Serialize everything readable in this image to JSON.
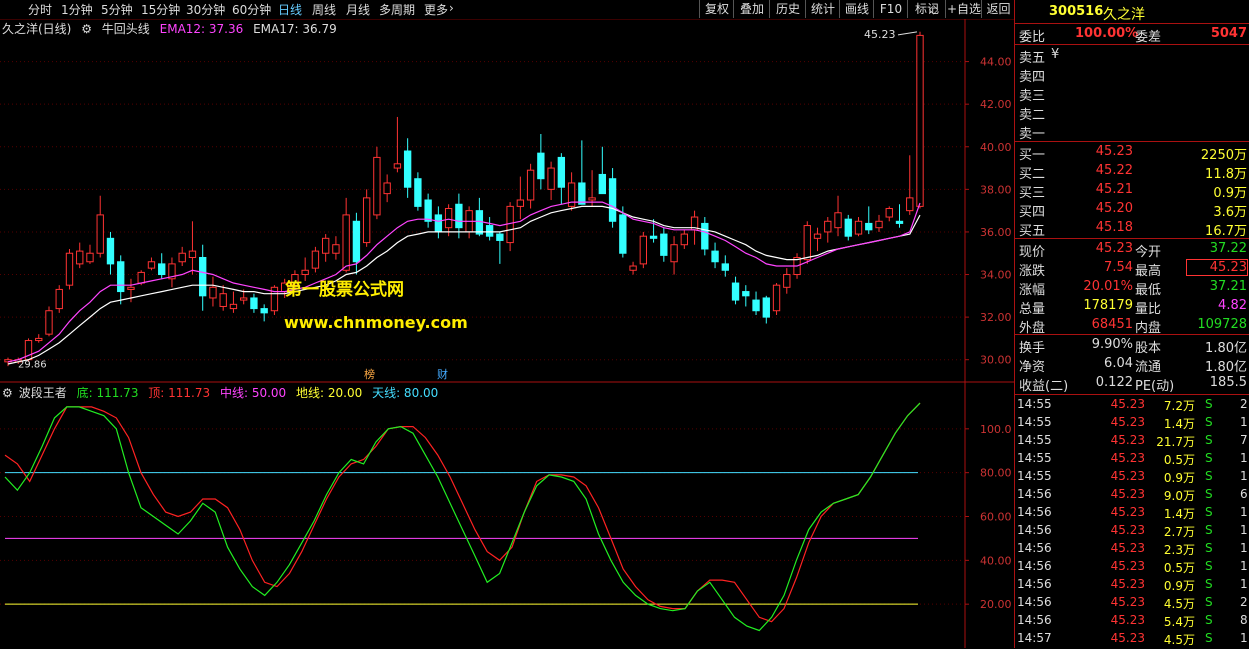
{
  "toolbar": {
    "tabs": [
      "分时",
      "1分钟",
      "5分钟",
      "15分钟",
      "30分钟",
      "60分钟",
      "日线",
      "周线",
      "月线",
      "多周期",
      "更多"
    ],
    "active": "日线",
    "more_arrow": "›",
    "right_buttons": [
      "复权",
      "叠加",
      "历史",
      "统计",
      "画线",
      "F10",
      "标记",
      "+自选",
      "返回"
    ],
    "diamond": "◇"
  },
  "main_legend": {
    "stock": "久之洋(日线)",
    "indicator": "牛回头线",
    "ema12": "EMA12: 37.36",
    "ema17": "EMA17: 36.79"
  },
  "price_axis": [
    "44.00",
    "42.00",
    "40.00",
    "38.00",
    "36.00",
    "34.00",
    "32.00",
    "30.00"
  ],
  "annotations": {
    "high": "45.23",
    "low": "29.86",
    "watermark1": "第一股票公式网",
    "watermark2": "www.chnmoney.com",
    "mark1": "榜",
    "mark2": "财"
  },
  "sub_legend": {
    "name": "波段王者",
    "di": "底: 111.73",
    "ding": "顶: 111.73",
    "mid": "中线: 50.00",
    "floor": "地线: 20.00",
    "sky": "天线: 80.00"
  },
  "sub_axis": [
    "100.0",
    "80.00",
    "60.00",
    "40.00",
    "20.00"
  ],
  "colors": {
    "up": "#ff3333",
    "down": "#33ffff",
    "ema12": "#ff44ff",
    "ema17": "#ffffff",
    "sky": "#44ddff",
    "mid": "#ff44ff",
    "floor": "#ffff33"
  },
  "chart_data": {
    "type": "candlestick",
    "candles": [
      [
        29.9,
        30.1,
        29.7,
        30.0
      ],
      [
        29.9,
        30.1,
        29.8,
        30.0
      ],
      [
        30.0,
        31.0,
        29.9,
        30.9
      ],
      [
        30.9,
        31.2,
        30.8,
        31.0
      ],
      [
        31.2,
        32.5,
        31.1,
        32.3
      ],
      [
        32.4,
        33.5,
        32.2,
        33.3
      ],
      [
        33.5,
        35.2,
        33.3,
        35.0
      ],
      [
        34.5,
        35.5,
        34.3,
        35.1
      ],
      [
        34.6,
        35.4,
        34.5,
        35.0
      ],
      [
        35.0,
        37.7,
        34.8,
        36.8
      ],
      [
        35.7,
        36.0,
        34.0,
        34.5
      ],
      [
        34.6,
        34.9,
        32.6,
        33.2
      ],
      [
        33.3,
        33.8,
        32.7,
        33.4
      ],
      [
        33.6,
        34.2,
        33.5,
        34.1
      ],
      [
        34.3,
        34.8,
        34.2,
        34.6
      ],
      [
        34.5,
        35.0,
        33.8,
        34.0
      ],
      [
        33.8,
        34.8,
        33.4,
        34.5
      ],
      [
        34.6,
        35.3,
        34.4,
        35.0
      ],
      [
        34.8,
        36.5,
        34.0,
        35.1
      ],
      [
        34.8,
        35.4,
        32.3,
        33.0
      ],
      [
        32.9,
        33.9,
        32.5,
        33.4
      ],
      [
        32.5,
        33.5,
        32.3,
        33.1
      ],
      [
        32.4,
        33.2,
        32.2,
        32.6
      ],
      [
        32.8,
        33.3,
        32.6,
        32.9
      ],
      [
        32.9,
        33.1,
        32.2,
        32.4
      ],
      [
        32.4,
        32.6,
        31.8,
        32.2
      ],
      [
        32.3,
        33.5,
        32.1,
        33.4
      ],
      [
        33.2,
        33.8,
        32.9,
        33.6
      ],
      [
        33.5,
        34.2,
        33.3,
        34.0
      ],
      [
        34.0,
        34.8,
        33.7,
        34.2
      ],
      [
        34.3,
        35.3,
        34.1,
        35.1
      ],
      [
        35.0,
        35.9,
        34.6,
        35.7
      ],
      [
        35.0,
        35.8,
        34.7,
        35.4
      ],
      [
        34.2,
        37.6,
        34.1,
        36.8
      ],
      [
        36.5,
        36.9,
        34.0,
        34.6
      ],
      [
        35.5,
        38.0,
        35.3,
        37.6
      ],
      [
        36.8,
        40.0,
        36.6,
        39.5
      ],
      [
        37.8,
        38.7,
        37.4,
        38.3
      ],
      [
        39.0,
        41.4,
        38.8,
        39.2
      ],
      [
        39.8,
        40.4,
        37.6,
        38.1
      ],
      [
        38.5,
        38.8,
        37.0,
        37.2
      ],
      [
        37.5,
        37.8,
        36.2,
        36.5
      ],
      [
        36.8,
        37.2,
        35.7,
        36.0
      ],
      [
        36.2,
        37.3,
        35.8,
        37.1
      ],
      [
        37.3,
        37.8,
        35.7,
        36.2
      ],
      [
        36.0,
        37.2,
        35.7,
        37.0
      ],
      [
        37.0,
        37.6,
        35.8,
        35.9
      ],
      [
        36.3,
        36.7,
        35.6,
        35.8
      ],
      [
        35.9,
        36.0,
        34.5,
        35.6
      ],
      [
        35.5,
        37.4,
        35.1,
        37.2
      ],
      [
        37.2,
        38.6,
        36.6,
        37.5
      ],
      [
        37.5,
        39.2,
        37.1,
        38.9
      ],
      [
        39.7,
        40.6,
        38.0,
        38.5
      ],
      [
        38.0,
        39.3,
        37.5,
        39.0
      ],
      [
        39.5,
        39.7,
        37.3,
        38.1
      ],
      [
        37.2,
        38.8,
        37.0,
        38.3
      ],
      [
        38.3,
        40.3,
        37.8,
        37.3
      ],
      [
        37.5,
        38.9,
        37.2,
        37.6
      ],
      [
        38.7,
        40.0,
        38.3,
        37.8
      ],
      [
        38.5,
        39.0,
        36.2,
        36.5
      ],
      [
        36.8,
        37.2,
        34.8,
        35.0
      ],
      [
        34.2,
        34.6,
        34.0,
        34.4
      ],
      [
        34.5,
        36.0,
        34.3,
        35.8
      ],
      [
        35.8,
        36.6,
        35.5,
        35.7
      ],
      [
        35.9,
        36.2,
        34.6,
        34.9
      ],
      [
        34.6,
        35.8,
        34.0,
        35.4
      ],
      [
        35.4,
        36.1,
        35.2,
        35.9
      ],
      [
        36.1,
        37.0,
        35.4,
        36.7
      ],
      [
        36.4,
        36.7,
        34.9,
        35.2
      ],
      [
        35.1,
        35.5,
        34.3,
        34.6
      ],
      [
        34.5,
        34.9,
        33.9,
        34.2
      ],
      [
        33.6,
        33.9,
        32.6,
        32.8
      ],
      [
        33.2,
        33.5,
        32.5,
        33.0
      ],
      [
        32.8,
        33.2,
        32.1,
        32.3
      ],
      [
        32.9,
        33.0,
        31.7,
        32.0
      ],
      [
        32.3,
        33.6,
        32.1,
        33.5
      ],
      [
        33.4,
        34.3,
        33.1,
        34.0
      ],
      [
        34.0,
        35.0,
        33.8,
        34.8
      ],
      [
        34.7,
        36.5,
        34.5,
        36.3
      ],
      [
        35.7,
        36.2,
        35.1,
        35.9
      ],
      [
        36.0,
        36.7,
        35.5,
        36.5
      ],
      [
        36.2,
        37.7,
        35.8,
        36.9
      ],
      [
        36.6,
        36.8,
        35.6,
        35.8
      ],
      [
        35.9,
        36.7,
        35.8,
        36.5
      ],
      [
        36.4,
        37.2,
        35.9,
        36.1
      ],
      [
        36.2,
        36.8,
        36.0,
        36.5
      ],
      [
        36.7,
        37.2,
        36.5,
        37.1
      ],
      [
        36.5,
        37.3,
        36.2,
        36.4
      ],
      [
        37.0,
        39.6,
        36.8,
        37.6
      ],
      [
        37.2,
        45.4,
        37.1,
        45.23
      ]
    ],
    "ema12": [
      29.9,
      30.0,
      30.2,
      30.4,
      30.8,
      31.2,
      31.8,
      32.3,
      32.7,
      33.2,
      33.5,
      33.5,
      33.5,
      33.6,
      33.7,
      33.8,
      33.9,
      34.0,
      34.2,
      34.1,
      34.0,
      33.8,
      33.6,
      33.5,
      33.4,
      33.3,
      33.2,
      33.2,
      33.3,
      33.4,
      33.6,
      33.8,
      34.0,
      34.4,
      34.5,
      34.9,
      35.4,
      35.8,
      36.2,
      36.5,
      36.6,
      36.6,
      36.5,
      36.6,
      36.5,
      36.5,
      36.5,
      36.4,
      36.3,
      36.4,
      36.5,
      36.8,
      37.0,
      37.2,
      37.3,
      37.4,
      37.4,
      37.4,
      37.4,
      37.2,
      36.9,
      36.6,
      36.5,
      36.4,
      36.2,
      36.1,
      36.1,
      36.1,
      36.0,
      35.8,
      35.6,
      35.3,
      35.0,
      34.8,
      34.5,
      34.4,
      34.4,
      34.4,
      34.6,
      34.8,
      35.0,
      35.2,
      35.3,
      35.4,
      35.5,
      35.6,
      35.7,
      35.8,
      36.0,
      37.36
    ],
    "ema17": [
      29.8,
      29.9,
      30.0,
      30.2,
      30.5,
      30.8,
      31.2,
      31.6,
      32.0,
      32.4,
      32.7,
      32.8,
      32.9,
      33.0,
      33.1,
      33.2,
      33.3,
      33.4,
      33.5,
      33.5,
      33.5,
      33.4,
      33.3,
      33.2,
      33.2,
      33.1,
      33.1,
      33.1,
      33.2,
      33.3,
      33.4,
      33.5,
      33.7,
      34.0,
      34.1,
      34.4,
      34.8,
      35.1,
      35.5,
      35.8,
      35.9,
      36.0,
      36.0,
      36.0,
      36.0,
      36.0,
      36.0,
      36.0,
      36.0,
      36.1,
      36.2,
      36.5,
      36.7,
      36.9,
      37.0,
      37.1,
      37.2,
      37.2,
      37.2,
      37.1,
      36.9,
      36.7,
      36.6,
      36.5,
      36.3,
      36.2,
      36.2,
      36.2,
      36.1,
      36.0,
      35.8,
      35.6,
      35.4,
      35.1,
      34.9,
      34.8,
      34.7,
      34.7,
      34.8,
      34.9,
      35.1,
      35.2,
      35.3,
      35.4,
      35.5,
      35.6,
      35.7,
      35.8,
      35.9,
      36.79
    ],
    "price_range": [
      29.0,
      46.0
    ],
    "wave_green": [
      78,
      72,
      80,
      92,
      105,
      110,
      110,
      108,
      106,
      100,
      80,
      64,
      60,
      56,
      52,
      58,
      66,
      62,
      46,
      36,
      28,
      24,
      30,
      38,
      48,
      58,
      70,
      80,
      86,
      84,
      94,
      100,
      101,
      98,
      88,
      78,
      66,
      54,
      42,
      30,
      34,
      48,
      62,
      74,
      79,
      78,
      76,
      68,
      52,
      40,
      30,
      24,
      20,
      18,
      17,
      18,
      26,
      30,
      22,
      14,
      10,
      8,
      14,
      24,
      40,
      54,
      62,
      66,
      68,
      70,
      78,
      88,
      98,
      106,
      111.73
    ],
    "wave_red": [
      88,
      84,
      76,
      88,
      100,
      110,
      110,
      110,
      108,
      105,
      96,
      80,
      70,
      62,
      60,
      62,
      68,
      68,
      64,
      54,
      40,
      30,
      28,
      34,
      44,
      56,
      68,
      78,
      84,
      86,
      92,
      100,
      101,
      101,
      96,
      88,
      78,
      66,
      54,
      44,
      40,
      46,
      62,
      76,
      79,
      79,
      78,
      74,
      64,
      50,
      36,
      28,
      22,
      19,
      18,
      18,
      26,
      31,
      31,
      30,
      22,
      14,
      12,
      18,
      32,
      48,
      60,
      66,
      68,
      70,
      78,
      88,
      98,
      106,
      111.73
    ],
    "sub_range": [
      0,
      120
    ],
    "levels": {
      "sky": 80,
      "mid": 50,
      "floor": 20
    }
  },
  "sidebar": {
    "code": "300516",
    "name": "久之洋",
    "weibi_label": "委比",
    "weibi": "100.00%",
    "weicha_label": "委差",
    "weicha": "5047",
    "sell": [
      {
        "label": "卖五",
        "extra": "¥"
      },
      {
        "label": "卖四",
        "extra": ""
      },
      {
        "label": "卖三",
        "extra": ""
      },
      {
        "label": "卖二",
        "extra": ""
      },
      {
        "label": "卖一",
        "extra": ""
      }
    ],
    "buy": [
      {
        "label": "买一",
        "price": "45.23",
        "vol": "2250万"
      },
      {
        "label": "买二",
        "price": "45.22",
        "vol": "11.8万"
      },
      {
        "label": "买三",
        "price": "45.21",
        "vol": "0.9万"
      },
      {
        "label": "买四",
        "price": "45.20",
        "vol": "3.6万"
      },
      {
        "label": "买五",
        "price": "45.18",
        "vol": "16.7万"
      }
    ],
    "stats": [
      {
        "l1": "现价",
        "v1": "45.23",
        "c1": "red",
        "l2": "今开",
        "v2": "37.22",
        "c2": "green"
      },
      {
        "l1": "涨跌",
        "v1": "7.54",
        "c1": "red",
        "l2": "最高",
        "v2": "45.23",
        "c2": "red"
      },
      {
        "l1": "涨幅",
        "v1": "20.01%",
        "c1": "red",
        "l2": "最低",
        "v2": "37.21",
        "c2": "green"
      },
      {
        "l1": "总量",
        "v1": "178179",
        "c1": "yellow",
        "l2": "量比",
        "v2": "4.82",
        "c2": "magenta"
      },
      {
        "l1": "外盘",
        "v1": "68451",
        "c1": "red",
        "l2": "内盘",
        "v2": "109728",
        "c2": "green"
      }
    ],
    "stats2": [
      {
        "l1": "换手",
        "v1": "9.90%",
        "l2": "股本",
        "v2": "1.80亿"
      },
      {
        "l1": "净资",
        "v1": "6.04",
        "l2": "流通",
        "v2": "1.80亿"
      },
      {
        "l1": "收益(二)",
        "v1": "0.122",
        "l2": "PE(动)",
        "v2": "185.5"
      }
    ],
    "ticks": [
      {
        "t": "14:55",
        "p": "45.23",
        "v": "7.2万",
        "s": "S",
        "n": "2"
      },
      {
        "t": "14:55",
        "p": "45.23",
        "v": "1.4万",
        "s": "S",
        "n": "1"
      },
      {
        "t": "14:55",
        "p": "45.23",
        "v": "21.7万",
        "s": "S",
        "n": "7"
      },
      {
        "t": "14:55",
        "p": "45.23",
        "v": "0.5万",
        "s": "S",
        "n": "1"
      },
      {
        "t": "14:55",
        "p": "45.23",
        "v": "0.9万",
        "s": "S",
        "n": "1"
      },
      {
        "t": "14:56",
        "p": "45.23",
        "v": "9.0万",
        "s": "S",
        "n": "6"
      },
      {
        "t": "14:56",
        "p": "45.23",
        "v": "1.4万",
        "s": "S",
        "n": "1"
      },
      {
        "t": "14:56",
        "p": "45.23",
        "v": "2.7万",
        "s": "S",
        "n": "1"
      },
      {
        "t": "14:56",
        "p": "45.23",
        "v": "2.3万",
        "s": "S",
        "n": "1"
      },
      {
        "t": "14:56",
        "p": "45.23",
        "v": "0.5万",
        "s": "S",
        "n": "1"
      },
      {
        "t": "14:56",
        "p": "45.23",
        "v": "0.9万",
        "s": "S",
        "n": "1"
      },
      {
        "t": "14:56",
        "p": "45.23",
        "v": "4.5万",
        "s": "S",
        "n": "2"
      },
      {
        "t": "14:56",
        "p": "45.23",
        "v": "5.4万",
        "s": "S",
        "n": "8"
      },
      {
        "t": "14:57",
        "p": "45.23",
        "v": "4.5万",
        "s": "S",
        "n": "1"
      }
    ]
  }
}
